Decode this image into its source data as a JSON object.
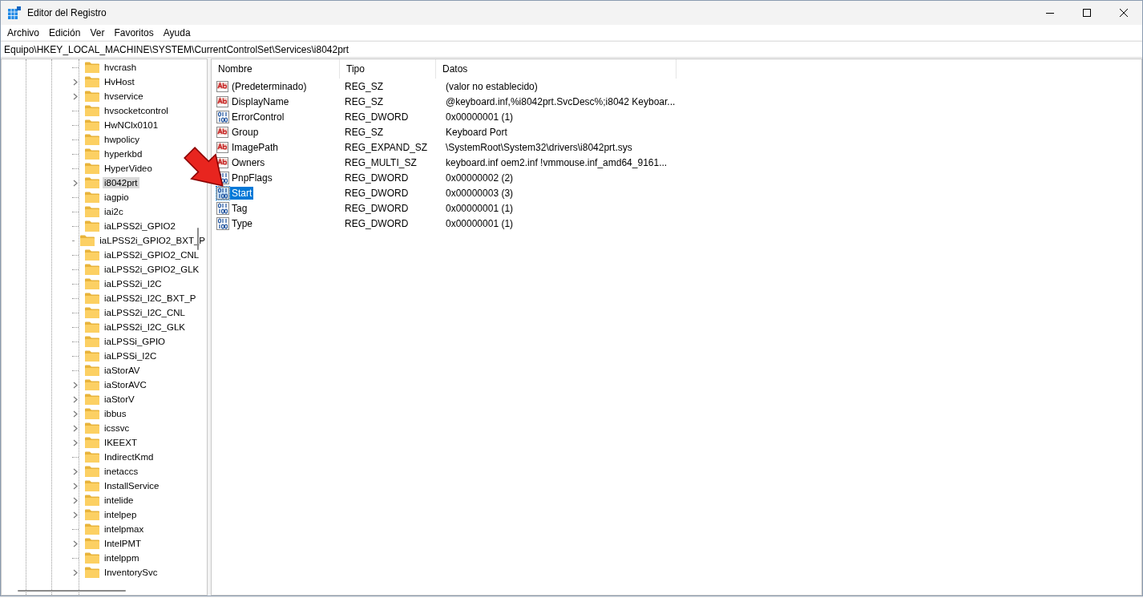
{
  "window": {
    "title": "Editor del Registro"
  },
  "menu": [
    "Archivo",
    "Edición",
    "Ver",
    "Favoritos",
    "Ayuda"
  ],
  "address": "Equipo\\HKEY_LOCAL_MACHINE\\SYSTEM\\CurrentControlSet\\Services\\i8042prt",
  "tree": [
    {
      "label": "hvcrash",
      "expandable": false,
      "selected": false
    },
    {
      "label": "HvHost",
      "expandable": true,
      "selected": false
    },
    {
      "label": "hvservice",
      "expandable": true,
      "selected": false
    },
    {
      "label": "hvsocketcontrol",
      "expandable": false,
      "selected": false
    },
    {
      "label": "HwNClx0101",
      "expandable": false,
      "selected": false
    },
    {
      "label": "hwpolicy",
      "expandable": false,
      "selected": false
    },
    {
      "label": "hyperkbd",
      "expandable": false,
      "selected": false
    },
    {
      "label": "HyperVideo",
      "expandable": false,
      "selected": false
    },
    {
      "label": "i8042prt",
      "expandable": true,
      "selected": true
    },
    {
      "label": "iagpio",
      "expandable": false,
      "selected": false
    },
    {
      "label": "iai2c",
      "expandable": false,
      "selected": false
    },
    {
      "label": "iaLPSS2i_GPIO2",
      "expandable": false,
      "selected": false
    },
    {
      "label": "iaLPSS2i_GPIO2_BXT_P",
      "expandable": false,
      "selected": false
    },
    {
      "label": "iaLPSS2i_GPIO2_CNL",
      "expandable": false,
      "selected": false
    },
    {
      "label": "iaLPSS2i_GPIO2_GLK",
      "expandable": false,
      "selected": false
    },
    {
      "label": "iaLPSS2i_I2C",
      "expandable": false,
      "selected": false
    },
    {
      "label": "iaLPSS2i_I2C_BXT_P",
      "expandable": false,
      "selected": false
    },
    {
      "label": "iaLPSS2i_I2C_CNL",
      "expandable": false,
      "selected": false
    },
    {
      "label": "iaLPSS2i_I2C_GLK",
      "expandable": false,
      "selected": false
    },
    {
      "label": "iaLPSSi_GPIO",
      "expandable": false,
      "selected": false
    },
    {
      "label": "iaLPSSi_I2C",
      "expandable": false,
      "selected": false
    },
    {
      "label": "iaStorAV",
      "expandable": false,
      "selected": false
    },
    {
      "label": "iaStorAVC",
      "expandable": true,
      "selected": false
    },
    {
      "label": "iaStorV",
      "expandable": true,
      "selected": false
    },
    {
      "label": "ibbus",
      "expandable": true,
      "selected": false
    },
    {
      "label": "icssvc",
      "expandable": true,
      "selected": false
    },
    {
      "label": "IKEEXT",
      "expandable": true,
      "selected": false
    },
    {
      "label": "IndirectKmd",
      "expandable": false,
      "selected": false
    },
    {
      "label": "inetaccs",
      "expandable": true,
      "selected": false
    },
    {
      "label": "InstallService",
      "expandable": true,
      "selected": false
    },
    {
      "label": "intelide",
      "expandable": true,
      "selected": false
    },
    {
      "label": "intelpep",
      "expandable": true,
      "selected": false
    },
    {
      "label": "intelpmax",
      "expandable": false,
      "selected": false
    },
    {
      "label": "IntelPMT",
      "expandable": true,
      "selected": false
    },
    {
      "label": "intelppm",
      "expandable": false,
      "selected": false
    },
    {
      "label": "InventorySvc",
      "expandable": true,
      "selected": false
    }
  ],
  "table": {
    "columns": [
      "Nombre",
      "Tipo",
      "Datos"
    ],
    "rows": [
      {
        "kind": "string",
        "name": "(Predeterminado)",
        "type": "REG_SZ",
        "data": "(valor no establecido)",
        "selected": false
      },
      {
        "kind": "string",
        "name": "DisplayName",
        "type": "REG_SZ",
        "data": "@keyboard.inf,%i8042prt.SvcDesc%;i8042 Keyboar...",
        "selected": false
      },
      {
        "kind": "binary",
        "name": "ErrorControl",
        "type": "REG_DWORD",
        "data": "0x00000001 (1)",
        "selected": false
      },
      {
        "kind": "string",
        "name": "Group",
        "type": "REG_SZ",
        "data": "Keyboard Port",
        "selected": false
      },
      {
        "kind": "string",
        "name": "ImagePath",
        "type": "REG_EXPAND_SZ",
        "data": "\\SystemRoot\\System32\\drivers\\i8042prt.sys",
        "selected": false
      },
      {
        "kind": "string",
        "name": "Owners",
        "type": "REG_MULTI_SZ",
        "data": "keyboard.inf oem2.inf !vmmouse.inf_amd64_9161...",
        "selected": false
      },
      {
        "kind": "binary",
        "name": "PnpFlags",
        "type": "REG_DWORD",
        "data": "0x00000002 (2)",
        "selected": false
      },
      {
        "kind": "binary",
        "name": "Start",
        "type": "REG_DWORD",
        "data": "0x00000003 (3)",
        "selected": true
      },
      {
        "kind": "binary",
        "name": "Tag",
        "type": "REG_DWORD",
        "data": "0x00000001 (1)",
        "selected": false
      },
      {
        "kind": "binary",
        "name": "Type",
        "type": "REG_DWORD",
        "data": "0x00000001 (1)",
        "selected": false
      }
    ]
  }
}
